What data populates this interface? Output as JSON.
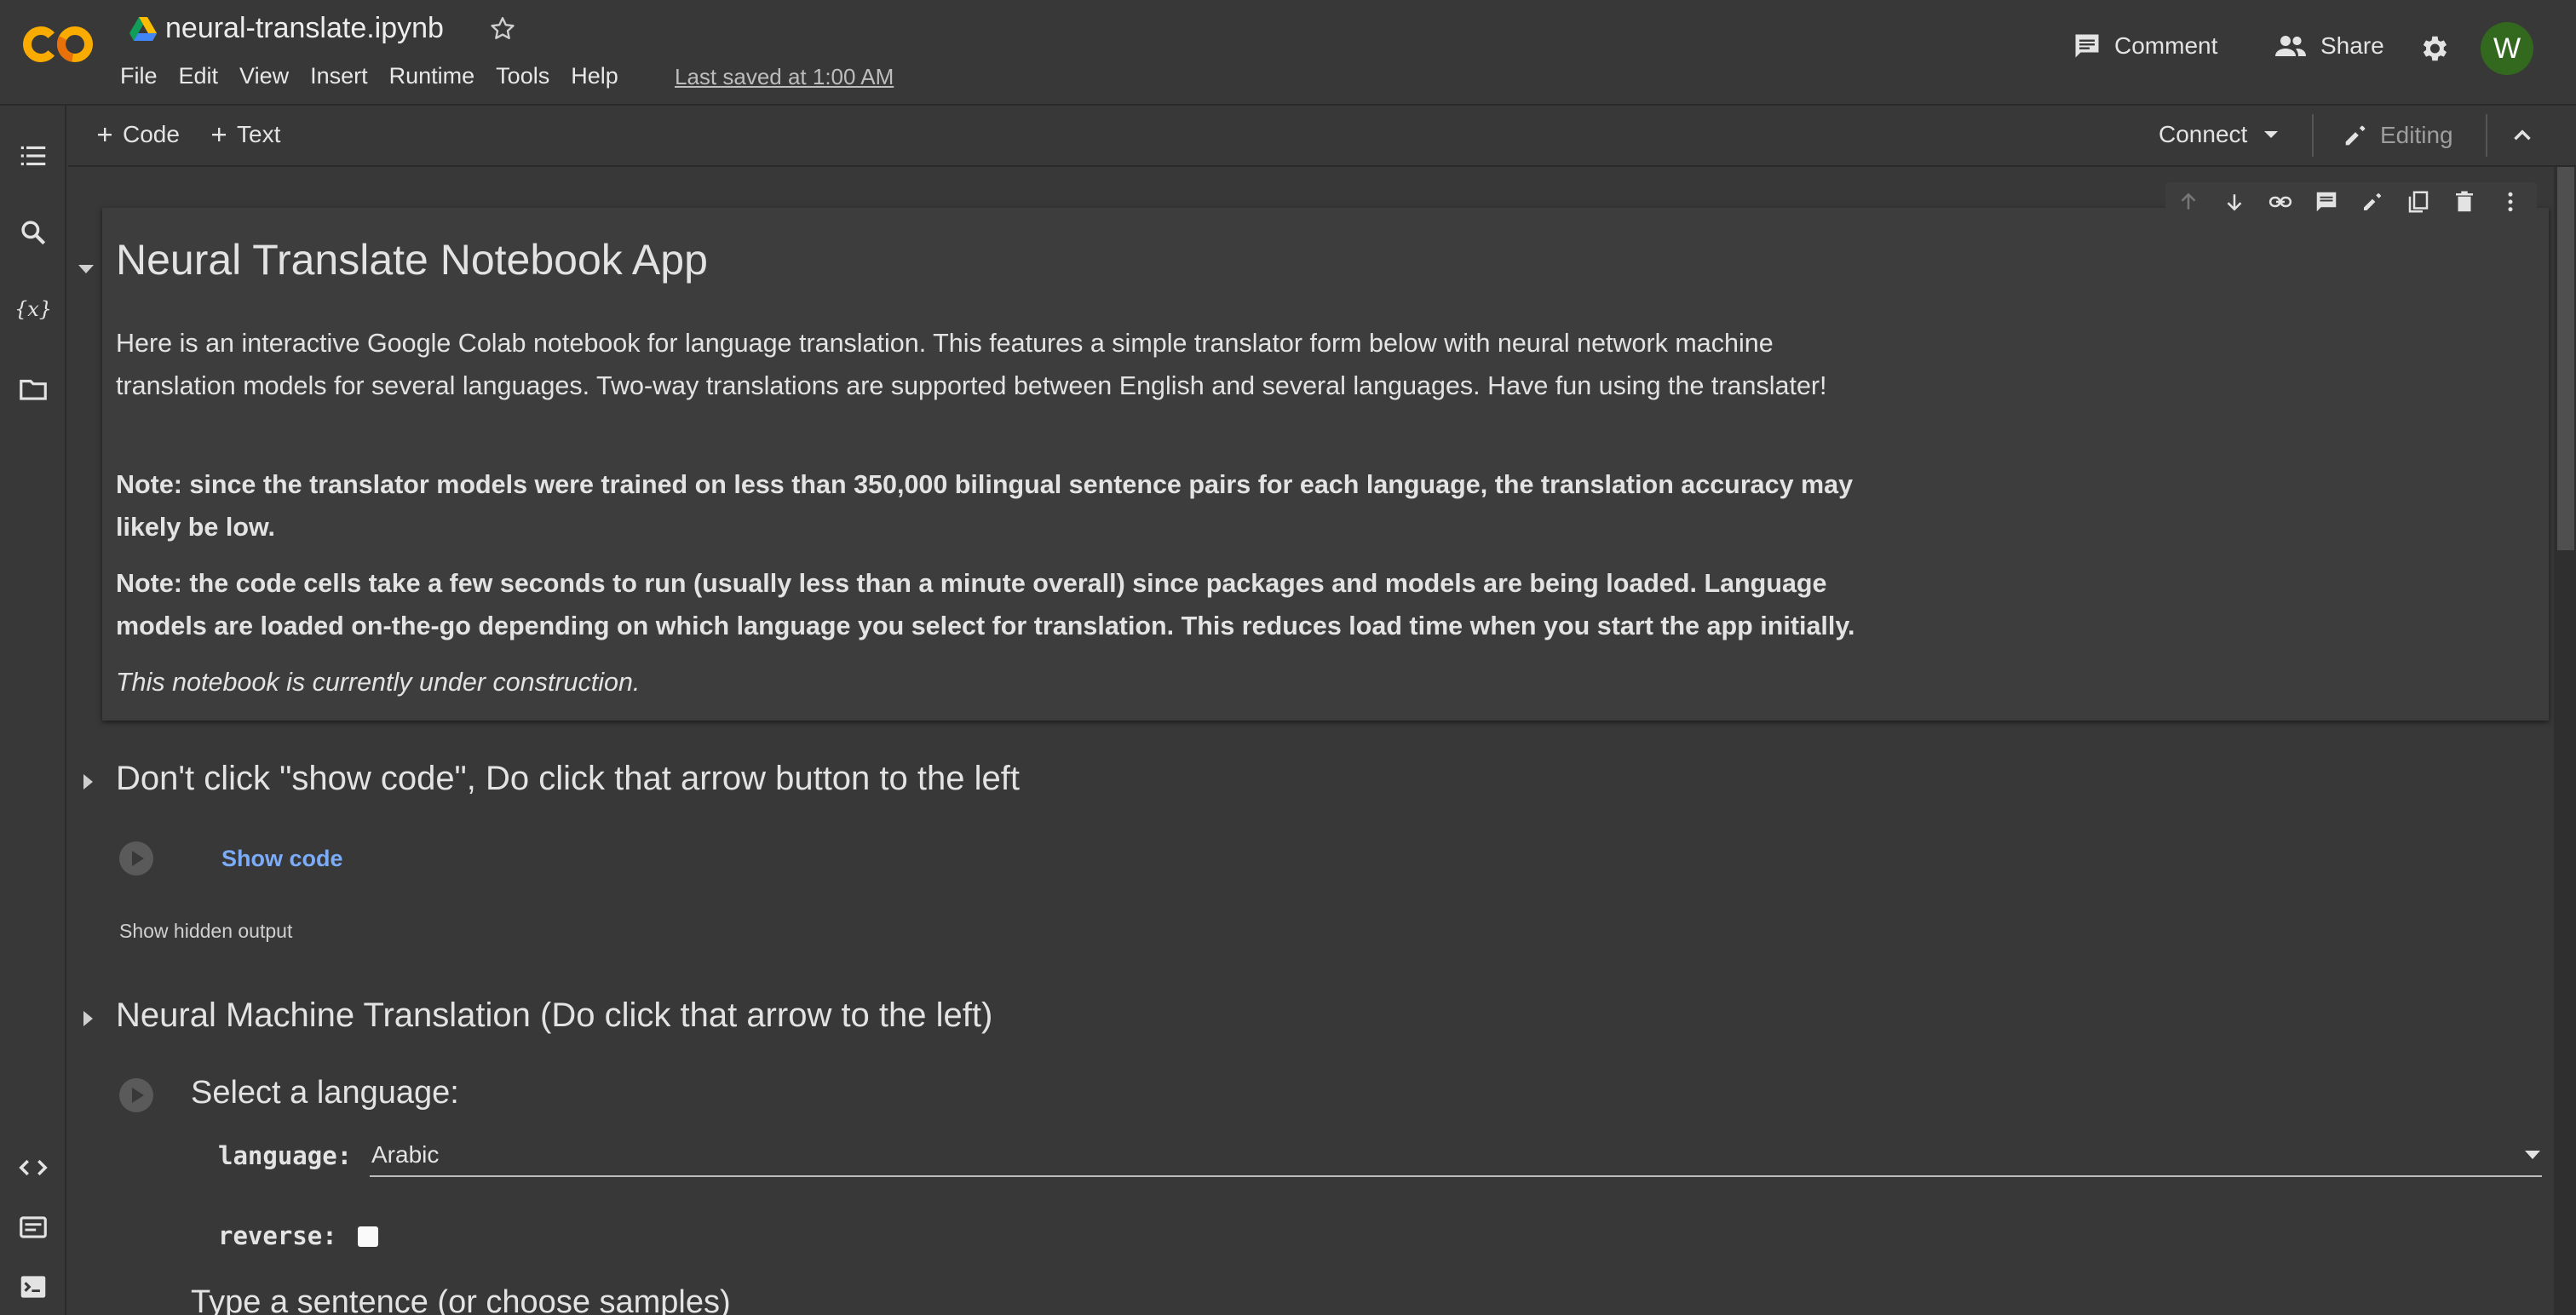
{
  "header": {
    "file_name": "neural-translate.ipynb",
    "menu": [
      "File",
      "Edit",
      "View",
      "Insert",
      "Runtime",
      "Tools",
      "Help"
    ],
    "last_saved": "Last saved at 1:00 AM",
    "comment_label": "Comment",
    "share_label": "Share",
    "avatar_letter": "W"
  },
  "toolbar": {
    "add_code": "Code",
    "add_text": "Text",
    "connect": "Connect",
    "editing": "Editing"
  },
  "icons": {
    "left_rail": [
      "toc-icon",
      "search-icon",
      "variables-icon",
      "folder-icon",
      "code-snippets-icon",
      "command-palette-icon",
      "terminal-icon"
    ],
    "cell_toolbar": [
      "arrow-up-icon",
      "arrow-down-icon",
      "link-icon",
      "comment-icon",
      "edit-icon",
      "mirror-cell-icon",
      "delete-icon",
      "more-vert-icon"
    ]
  },
  "text_cell": {
    "heading": "Neural Translate Notebook App",
    "paragraph_1": "Here is an interactive Google Colab notebook for language translation. This features a simple translator form below with neural network machine translation models for several languages. Two-way translations are supported between English and several languages. Have fun using the translater!",
    "paragraph_2": "Note: since the translator models were trained on less than 350,000 bilingual sentence pairs for each language, the translation accuracy may likely be low.",
    "paragraph_3": "Note: the code cells take a few seconds to run (usually less than a minute overall) since packages and models are being loaded. Language models are loaded on-the-go depending on which language you select for translation. This reduces load time when you start the app initially.",
    "paragraph_4": "This notebook is currently under construction."
  },
  "section_2": {
    "heading": "Don't click \"show code\", Do click that arrow button to the left",
    "show_code": "Show code",
    "show_hidden_output": "Show hidden output"
  },
  "section_3": {
    "heading": "Neural Machine Translation (Do click that arrow to the left)",
    "form_title": "Select a language:",
    "language_label": "language:",
    "language_value": "Arabic",
    "reverse_label": "reverse:",
    "reverse_checked": false,
    "form_subtitle": "Type a sentence (or choose samples)"
  },
  "colors": {
    "background": "#383838",
    "cell_background": "#3d3d3d",
    "link_blue": "#7cacf8",
    "avatar_green": "#33691e",
    "logo_orange": "#f9ab00"
  }
}
